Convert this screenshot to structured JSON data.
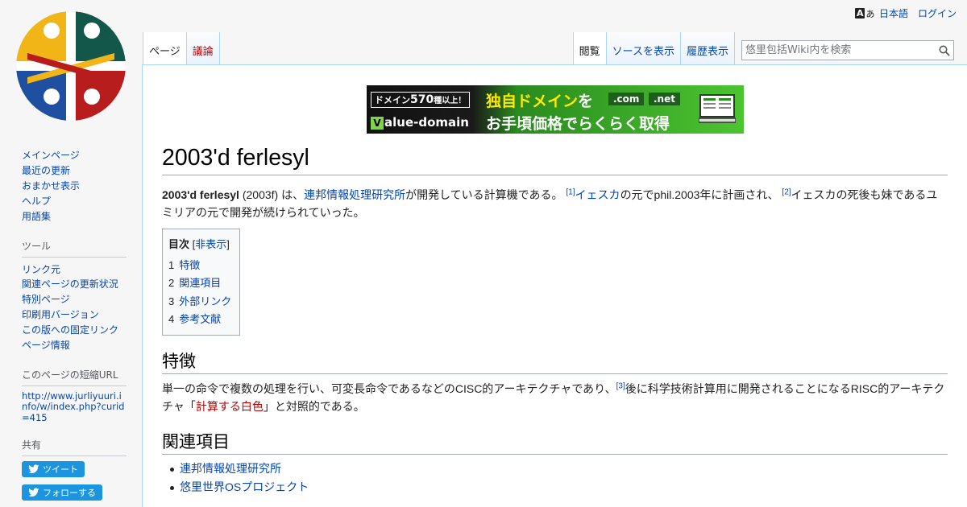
{
  "personal": {
    "lang_icon_a": "A",
    "lang_icon_b": "あ",
    "language": "日本語",
    "login": "ログイン"
  },
  "tabs": {
    "page": "ページ",
    "talk": "議論",
    "read": "閲覧",
    "view_source": "ソースを表示",
    "history": "履歴表示"
  },
  "search": {
    "placeholder": "悠里包括Wiki内を検索"
  },
  "sidebar": {
    "navigation": [
      "メインページ",
      "最近の更新",
      "おまかせ表示",
      "ヘルプ",
      "用語集"
    ],
    "tools_heading": "ツール",
    "tools": [
      "リンク元",
      "関連ページの更新状況",
      "特別ページ",
      "印刷用バージョン",
      "この版への固定リンク",
      "ページ情報"
    ],
    "shorturl_heading": "このページの短縮URL",
    "shorturl": "http://www.jurliyuuri.info/w/index.php?curid=415",
    "share_heading": "共有",
    "tweet": "ツイート",
    "follow": "フォローする"
  },
  "banner": {
    "top_a": "ドメイン",
    "top_b": "570",
    "top_c": "種以上！",
    "brand_v": "V",
    "brand_rest": "alue-domain",
    "headline_a": "独自ドメイン",
    "headline_b": "を",
    "headline2": "お手頃価格でらくらく取得",
    "tld1": ".com",
    "tld2": ".net"
  },
  "article": {
    "title": "2003'd ferlesyl",
    "intro": {
      "bold": "2003'd ferlesyl",
      "t1": " (2003f) は、",
      "link1": "連邦情報処理研究所",
      "t2": "が開発している計算機である。",
      "ref1": "[1]",
      "link2": "イェスカ",
      "t3": "の元でphil.2003年に計画され、",
      "ref2": "[2]",
      "t4": "イェスカの死後も妹であるユミリアの元で開発が続けられていった。"
    },
    "toc": {
      "title": "目次",
      "toggle_open": "[",
      "toggle": "非表示",
      "toggle_close": "]",
      "items": [
        {
          "num": "1",
          "label": "特徴"
        },
        {
          "num": "2",
          "label": "関連項目"
        },
        {
          "num": "3",
          "label": "外部リンク"
        },
        {
          "num": "4",
          "label": "参考文献"
        }
      ]
    },
    "section1": {
      "heading": "特徴",
      "t1": "単一の命令で複数の処理を行い、可変長命令であるなどのCISC的アーキテクチャであり、",
      "ref3": "[3]",
      "t2": "後に科学技術計算用に開発されることになるRISC的アーキテクチャ「",
      "redlink": "計算する白色",
      "t3": "」と対照的である。"
    },
    "section2": {
      "heading": "関連項目",
      "items": [
        "連邦情報処理研究所",
        "悠里世界OSプロジェクト"
      ]
    }
  }
}
